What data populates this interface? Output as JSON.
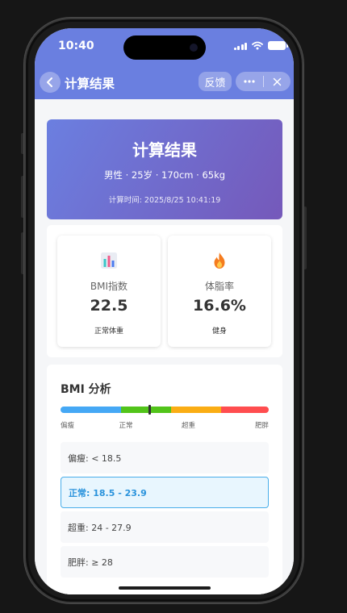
{
  "status_bar": {
    "time": "10:40"
  },
  "nav": {
    "title": "计算结果",
    "feedback_label": "反馈"
  },
  "hero": {
    "title": "计算结果",
    "subtitle": "男性 · 25岁 · 170cm · 65kg",
    "calc_time": "计算时间: 2025/8/25 10:41:19"
  },
  "metrics": [
    {
      "icon": "bar-chart-icon",
      "label": "BMI指数",
      "value": "22.5",
      "status": "正常体重"
    },
    {
      "icon": "fire-icon",
      "label": "体脂率",
      "value": "16.6%",
      "status": "健身"
    }
  ],
  "bmi_analysis": {
    "title": "BMI 分析",
    "scale": {
      "segments": [
        {
          "label": "偏瘦",
          "color": "#45a8f5",
          "fraction": 0.29
        },
        {
          "label": "正常",
          "color": "#52c41a",
          "fraction": 0.24
        },
        {
          "label": "超重",
          "color": "#faad14",
          "fraction": 0.24
        },
        {
          "label": "肥胖",
          "color": "#ff4d4f",
          "fraction": 0.23
        }
      ],
      "marker_fraction": 0.43
    },
    "ranges": [
      {
        "text": "偏瘦: < 18.5",
        "active": false
      },
      {
        "text": "正常: 18.5 - 23.9",
        "active": true
      },
      {
        "text": "超重: 24 - 27.9",
        "active": false
      },
      {
        "text": "肥胖: ≥ 28",
        "active": false
      }
    ]
  },
  "colors": {
    "accent": "#6a7fe0",
    "hero_start": "#6b7fe0",
    "hero_end": "#7559ba",
    "active_range": "#49aeea"
  }
}
